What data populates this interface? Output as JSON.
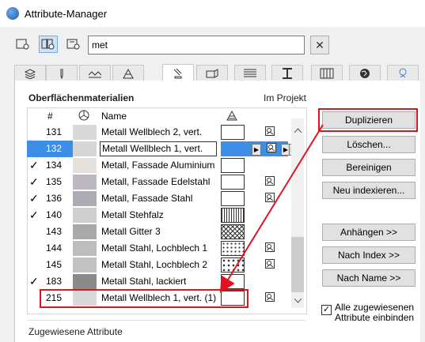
{
  "window": {
    "title": "Attribute-Manager"
  },
  "search": {
    "value": "met",
    "clear_label": "✕"
  },
  "section": {
    "title": "Oberflächenmaterialien",
    "in_project": "Im Projekt"
  },
  "list": {
    "headers": {
      "index": "#",
      "name": "Name"
    },
    "rows": [
      {
        "checked": "",
        "index": "131",
        "name": "Metall Wellblech 2, vert.",
        "swatch": "#d9d9d9",
        "pattern": "plain",
        "in_project": true,
        "selected": false
      },
      {
        "checked": "",
        "index": "132",
        "name": "Metall Wellblech 1, vert.",
        "swatch": "#d6d6d6",
        "pattern": "blue",
        "in_project": true,
        "selected": true
      },
      {
        "checked": "✓",
        "index": "134",
        "name": "Metall, Fassade Aluminium",
        "swatch": "#e6e1dc",
        "pattern": "plain",
        "in_project": false,
        "selected": false
      },
      {
        "checked": "✓",
        "index": "135",
        "name": "Metall, Fassade Edelstahl",
        "swatch": "#bdb9c3",
        "pattern": "plain",
        "in_project": true,
        "selected": false
      },
      {
        "checked": "✓",
        "index": "136",
        "name": "Metall, Fassade Stahl",
        "swatch": "#aeabb4",
        "pattern": "plain",
        "in_project": true,
        "selected": false
      },
      {
        "checked": "✓",
        "index": "140",
        "name": "Metall Stehfalz",
        "swatch": "#cfcfcf",
        "pattern": "vlines",
        "in_project": false,
        "selected": false
      },
      {
        "checked": "",
        "index": "143",
        "name": "Metall Gitter 3",
        "swatch": "#a9a9a9",
        "pattern": "cross",
        "in_project": false,
        "selected": false
      },
      {
        "checked": "",
        "index": "144",
        "name": "Metall Stahl, Lochblech 1",
        "swatch": "#bdbdbd",
        "pattern": "dots",
        "in_project": true,
        "selected": false
      },
      {
        "checked": "",
        "index": "145",
        "name": "Metall Stahl, Lochblech 2",
        "swatch": "#c2c2c2",
        "pattern": "dots2",
        "in_project": true,
        "selected": false
      },
      {
        "checked": "✓",
        "index": "183",
        "name": "Metall Stahl, lackiert",
        "swatch": "#8a8a8a",
        "pattern": "plain",
        "in_project": false,
        "selected": false
      },
      {
        "checked": "",
        "index": "215",
        "name": "Metall Wellblech 1, vert. (1)",
        "swatch": "#d9d9d9",
        "pattern": "plain",
        "in_project": true,
        "selected": false
      }
    ]
  },
  "buttons": {
    "duplicate": "Duplizieren",
    "delete": "Löschen...",
    "purge": "Bereinigen",
    "reindex": "Neu indexieren...",
    "append": "Anhängen >>",
    "by_index": "Nach Index >>",
    "by_name": "Nach Name >>"
  },
  "assigned_checkbox": {
    "label_line1": "Alle zugewiesenen",
    "label_line2": "Attribute einbinden",
    "checked": "✓"
  },
  "assigned_section": {
    "title": "Zugewiesene Attribute"
  },
  "tabs": [
    "layers-icon",
    "pen-icon",
    "line-icon",
    "fill-icon",
    "surface-icon",
    "composite-icon",
    "zone-icon",
    "profile-icon",
    "mep-icon",
    "globe-icon",
    "operation-icon"
  ],
  "colors": {
    "highlight": "#e0141e",
    "selection": "#3c8ee6"
  }
}
